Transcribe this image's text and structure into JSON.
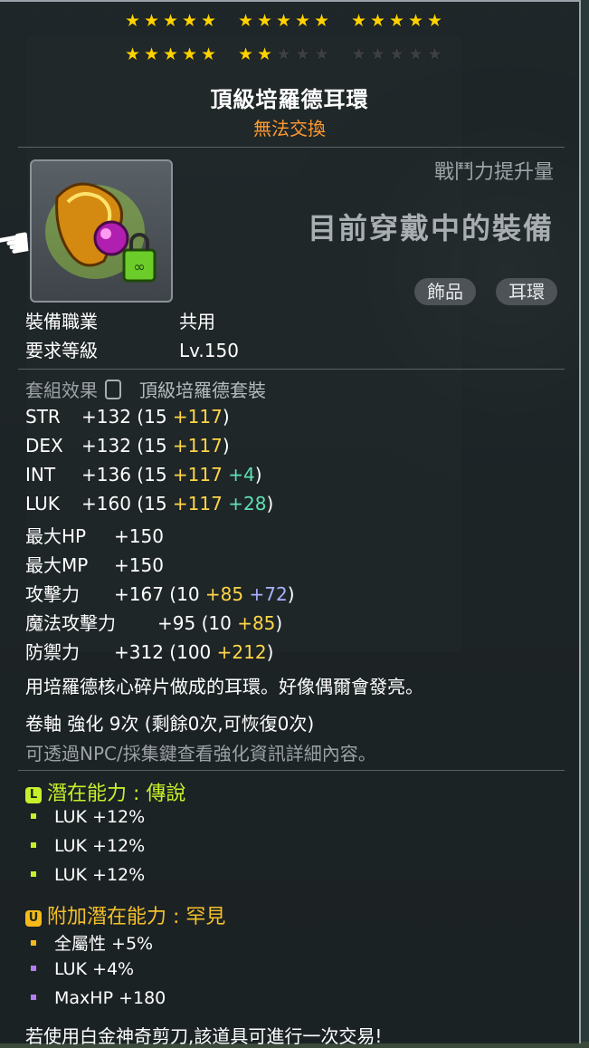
{
  "stars": {
    "row1": [
      5,
      5,
      5
    ],
    "row2_filled": [
      5,
      2,
      0
    ],
    "star_char": "★"
  },
  "item": {
    "name": "頂級培羅德耳環",
    "trade": "無法交換",
    "power_label": "戰鬥力提升量",
    "equipped_label": "目前穿戴中的裝備",
    "tags": [
      "飾品",
      "耳環"
    ]
  },
  "req": {
    "job_label": "裝備職業",
    "job_value": "共用",
    "level_label": "要求等級",
    "level_value": "Lv.150"
  },
  "set": {
    "label": "套組效果",
    "name": "頂級培羅德套裝"
  },
  "stats": [
    {
      "name": "STR",
      "total": "+132",
      "open": "(15",
      "bonus": "+117",
      "extra": "",
      "close": ")"
    },
    {
      "name": "DEX",
      "total": "+132",
      "open": "(15",
      "bonus": "+117",
      "extra": "",
      "close": ")"
    },
    {
      "name": "INT",
      "total": "+136",
      "open": "(15",
      "bonus": "+117",
      "extra": "+4",
      "close": ")"
    },
    {
      "name": "LUK",
      "total": "+160",
      "open": "(15",
      "bonus": "+117",
      "extra": "+28",
      "close": ")"
    },
    {
      "name": "最大HP",
      "total": "+150",
      "open": "",
      "bonus": "",
      "extra": "",
      "close": ""
    },
    {
      "name": "最大MP",
      "total": "+150",
      "open": "",
      "bonus": "",
      "extra": "",
      "close": ""
    },
    {
      "name": "攻擊力",
      "total": "+167",
      "open": "(10",
      "bonus": "+85",
      "extra": "+72",
      "close": ")"
    },
    {
      "name": "魔法攻擊力",
      "total": "+95",
      "open": "(10",
      "bonus": "+85",
      "extra": "",
      "close": ")"
    },
    {
      "name": "防禦力",
      "total": "+312",
      "open": "(100",
      "bonus": "+212",
      "extra": "",
      "close": ")"
    }
  ],
  "description": "用培羅德核心碎片做成的耳環。好像偶爾會發亮。",
  "enhance": {
    "line": "卷軸 強化 9次 (剩餘0次,可恢復0次)",
    "hint": "可透過NPC/採集鍵查看強化資訊詳細內容。"
  },
  "potential": {
    "badge": "L",
    "title": "潛在能力 : 傳說",
    "lines": [
      "LUK +12%",
      "LUK +12%",
      "LUK +12%"
    ]
  },
  "additional": {
    "badge": "U",
    "title": "附加潛在能力 : 罕見",
    "lines": [
      "全屬性 +5%",
      "LUK +4%",
      "MaxHP +180"
    ]
  },
  "footer": "若使用白金神奇剪刀,該道具可進行一次交易!",
  "colors": {
    "star_on": "#ffd200",
    "trade": "#ff9a2e",
    "bonus": "#ffd648",
    "extra_green": "#5fe0b3",
    "extra_purple": "#a9b2ff",
    "legend": "#c6f02c",
    "unique": "#f5b91b"
  }
}
